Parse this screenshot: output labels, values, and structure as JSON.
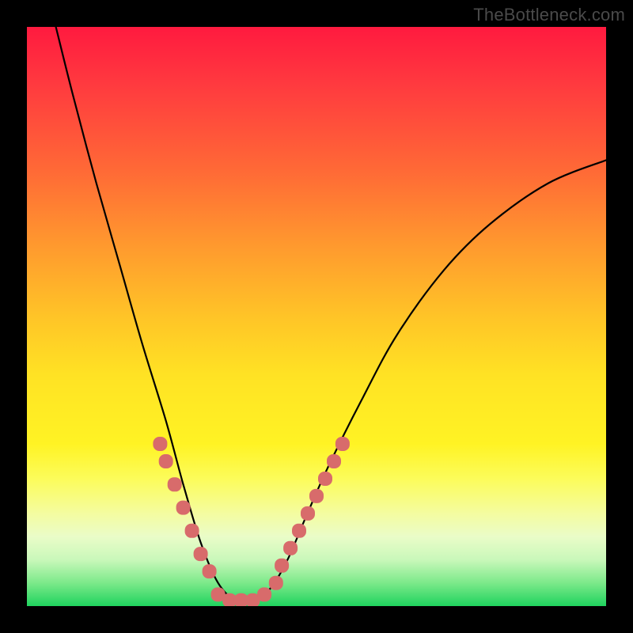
{
  "watermark": {
    "text": "TheBottleneck.com"
  },
  "colors": {
    "frame": "#000000",
    "curve": "#000000",
    "markers": "#d86b6b",
    "gradient_top": "#ff1a3f",
    "gradient_bottom": "#1fd35e"
  },
  "chart_data": {
    "type": "line",
    "title": "",
    "xlabel": "",
    "ylabel": "",
    "xlim": [
      0,
      100
    ],
    "ylim": [
      0,
      100
    ],
    "notes": "No axis ticks or labels visible in image; values are estimated from pixel positions. y is the bottleneck/mismatch metric (0 at bottom = green/good, 100 at top = red/bad). x is the swept parameter. Valley floor ~ x 33-42.",
    "series": [
      {
        "name": "curve",
        "x": [
          5,
          8,
          12,
          16,
          20,
          24,
          27,
          30,
          33,
          36,
          39,
          42,
          45,
          48,
          52,
          58,
          64,
          72,
          80,
          90,
          100
        ],
        "y": [
          100,
          88,
          73,
          59,
          45,
          32,
          21,
          11,
          4,
          1,
          1,
          3,
          8,
          15,
          24,
          36,
          47,
          58,
          66,
          73,
          77
        ]
      }
    ],
    "markers": [
      {
        "name": "left-cluster",
        "x": [
          23.0,
          24.0,
          25.5,
          27.0,
          28.5,
          30.0,
          31.5
        ],
        "y": [
          28,
          25,
          21,
          17,
          13,
          9,
          6
        ]
      },
      {
        "name": "valley-floor",
        "x": [
          33.0,
          35.0,
          37.0,
          39.0,
          41.0,
          43.0
        ],
        "y": [
          2,
          1,
          1,
          1,
          2,
          4
        ]
      },
      {
        "name": "right-cluster",
        "x": [
          44.0,
          45.5,
          47.0,
          48.5,
          50.0,
          51.5,
          53.0,
          54.5
        ],
        "y": [
          7,
          10,
          13,
          16,
          19,
          22,
          25,
          28
        ]
      }
    ]
  }
}
